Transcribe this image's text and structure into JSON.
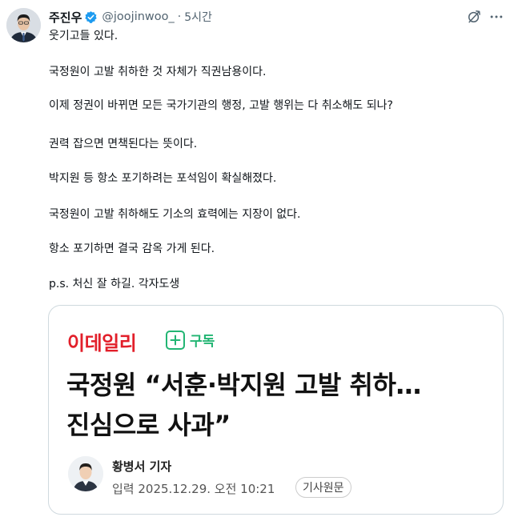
{
  "tweet": {
    "author": {
      "display_name": "주진우",
      "handle": "@joojinwoo_",
      "verified": true,
      "verified_color": "#1d9bf0"
    },
    "separator": "·",
    "time": "5시간",
    "icons": {
      "grok": "grok-icon",
      "more": "more-icon"
    },
    "body": [
      "웃기고들 있다.",
      "국정원이 고발 취하한 것 자체가 직권남용이다.",
      "이제 정권이 바뀌면 모든 국가기관의 행정, 고발 행위는 다 취소해도 되나?",
      "권력 잡으면 면책된다는 뜻이다.",
      "박지원 등 항소 포기하려는 포석임이 확실해졌다.",
      "국정원이 고발 취하해도 기소의 효력에는 지장이 없다.",
      "항소 포기하면 결국 감옥 가게 된다.",
      "p.s. 처신 잘 하길. 각자도생"
    ]
  },
  "card": {
    "brand": "이데일리",
    "brand_color": "#e21f2a",
    "subscribe_label": "구독",
    "subscribe_color": "#22b573",
    "headline_lines": [
      "국정원 “서훈·박지원 고발 취하…",
      "진심으로 사과”"
    ],
    "reporter": "황병서 기자",
    "publish_info": "입력 2025.12.29. 오전 10:21",
    "original_button": "기사원문"
  }
}
